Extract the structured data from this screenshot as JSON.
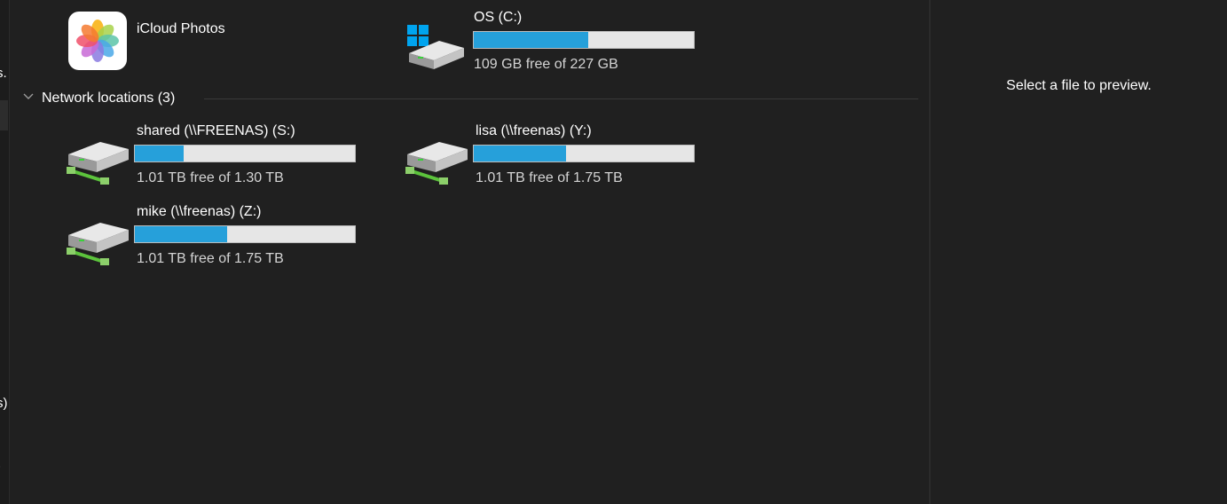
{
  "nav": {
    "fragments": [
      "s.",
      "s)",
      ")"
    ]
  },
  "devices": {
    "icloud": {
      "name": "iCloud Photos",
      "icon": "icloud-photos-icon"
    },
    "os_drive": {
      "name": "OS (C:)",
      "free_text": "109 GB free of 227 GB",
      "used_fraction": 0.52,
      "icon": "windows-drive-icon"
    }
  },
  "network": {
    "header": "Network locations (3)",
    "items": [
      {
        "name": "shared (\\\\FREENAS) (S:)",
        "free_text": "1.01 TB free of 1.30 TB",
        "used_fraction": 0.22,
        "icon": "network-drive-icon"
      },
      {
        "name": "lisa (\\\\freenas) (Y:)",
        "free_text": "1.01 TB free of 1.75 TB",
        "used_fraction": 0.42,
        "icon": "network-drive-icon"
      },
      {
        "name": "mike (\\\\freenas) (Z:)",
        "free_text": "1.01 TB free of 1.75 TB",
        "used_fraction": 0.42,
        "icon": "network-drive-icon"
      }
    ]
  },
  "preview": {
    "message": "Select a file to preview."
  },
  "colors": {
    "background": "#202020",
    "bar_fill": "#26a0da",
    "bar_track": "#e6e6e6",
    "windows_blue": "#00a4ef",
    "network_green": "#5cc33c"
  }
}
